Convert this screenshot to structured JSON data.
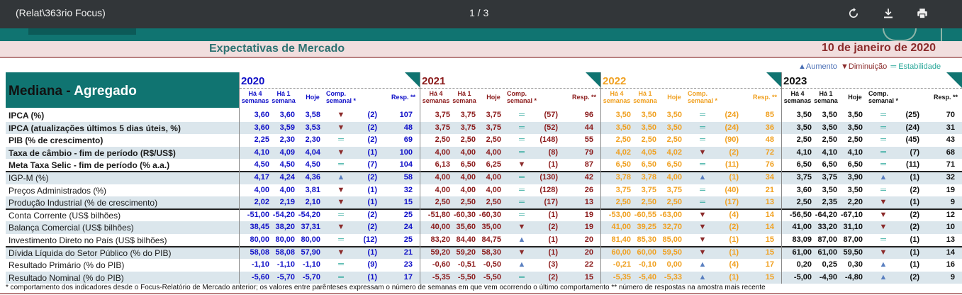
{
  "viewer": {
    "doc_title": "(Relat\\363rio Focus)",
    "page_indicator": "1 / 3"
  },
  "report": {
    "title": "Expectativas de Mercado",
    "date": "10 de janeiro de 2020",
    "table_heading_dark": "Mediana - ",
    "table_heading_white": "Agregado",
    "legend": {
      "up": "▲Aumento",
      "down": "▼Diminuição",
      "stable": "═ Estabilidade"
    },
    "col_headers": {
      "h4": "Há 4\nsemanas",
      "h1": "Há 1\nsemana",
      "hoje": "Hoje",
      "comp": "Comp.\nsemanal *",
      "resp": "Resp. **"
    },
    "footnote": "* comportamento dos indicadores desde o Focus-Relatório de Mercado anterior; os valores entre parênteses expressam o número de semanas em que vem ocorrendo o último comportamento ** número de respostas na amostra mais recente"
  },
  "colors": {
    "teal": "#107471",
    "y2020": "#1010c8",
    "y2021": "#8b1a1a",
    "y2022": "#f0a020",
    "y2023": "#111111"
  },
  "years": [
    "2020",
    "2021",
    "2022",
    "2023"
  ],
  "rows": [
    {
      "label": "IPCA (%)",
      "bold": true,
      "shade": false,
      "div": false,
      "y": [
        [
          "3,60",
          "3,60",
          "3,58",
          "d",
          "(2)",
          "107"
        ],
        [
          "3,75",
          "3,75",
          "3,75",
          "s",
          "(57)",
          "96"
        ],
        [
          "3,50",
          "3,50",
          "3,50",
          "s",
          "(24)",
          "85"
        ],
        [
          "3,50",
          "3,50",
          "3,50",
          "s",
          "(25)",
          "70"
        ]
      ]
    },
    {
      "label": "IPCA (atualizações últimos 5 dias úteis, %)",
      "bold": true,
      "shade": true,
      "div": false,
      "y": [
        [
          "3,60",
          "3,59",
          "3,53",
          "d",
          "(2)",
          "48"
        ],
        [
          "3,75",
          "3,75",
          "3,75",
          "s",
          "(52)",
          "44"
        ],
        [
          "3,50",
          "3,50",
          "3,50",
          "s",
          "(24)",
          "36"
        ],
        [
          "3,50",
          "3,50",
          "3,50",
          "s",
          "(24)",
          "31"
        ]
      ]
    },
    {
      "label": "PIB (% de crescimento)",
      "bold": true,
      "shade": false,
      "div": false,
      "y": [
        [
          "2,25",
          "2,30",
          "2,30",
          "s",
          "(2)",
          "69"
        ],
        [
          "2,50",
          "2,50",
          "2,50",
          "s",
          "(148)",
          "55"
        ],
        [
          "2,50",
          "2,50",
          "2,50",
          "s",
          "(90)",
          "48"
        ],
        [
          "2,50",
          "2,50",
          "2,50",
          "s",
          "(45)",
          "43"
        ]
      ]
    },
    {
      "label": "Taxa de câmbio - fim de período (R$/US$)",
      "bold": true,
      "shade": true,
      "div": false,
      "y": [
        [
          "4,10",
          "4,09",
          "4,04",
          "d",
          "(1)",
          "100"
        ],
        [
          "4,00",
          "4,00",
          "4,00",
          "s",
          "(8)",
          "79"
        ],
        [
          "4,02",
          "4,05",
          "4,02",
          "d",
          "(2)",
          "72"
        ],
        [
          "4,10",
          "4,10",
          "4,10",
          "s",
          "(7)",
          "68"
        ]
      ]
    },
    {
      "label": "Meta Taxa Selic - fim de período (% a.a.)",
      "bold": true,
      "shade": false,
      "div": false,
      "y": [
        [
          "4,50",
          "4,50",
          "4,50",
          "s",
          "(7)",
          "104"
        ],
        [
          "6,13",
          "6,50",
          "6,25",
          "d",
          "(1)",
          "87"
        ],
        [
          "6,50",
          "6,50",
          "6,50",
          "s",
          "(11)",
          "76"
        ],
        [
          "6,50",
          "6,50",
          "6,50",
          "s",
          "(11)",
          "71"
        ]
      ]
    },
    {
      "label": "IGP-M (%)",
      "bold": false,
      "shade": true,
      "div": true,
      "y": [
        [
          "4,17",
          "4,24",
          "4,36",
          "u",
          "(2)",
          "58"
        ],
        [
          "4,00",
          "4,00",
          "4,00",
          "s",
          "(130)",
          "42"
        ],
        [
          "3,78",
          "3,78",
          "4,00",
          "u",
          "(1)",
          "34"
        ],
        [
          "3,75",
          "3,75",
          "3,90",
          "u",
          "(1)",
          "32"
        ]
      ]
    },
    {
      "label": "Preços Administrados (%)",
      "bold": false,
      "shade": false,
      "div": false,
      "y": [
        [
          "4,00",
          "4,00",
          "3,81",
          "d",
          "(1)",
          "32"
        ],
        [
          "4,00",
          "4,00",
          "4,00",
          "s",
          "(128)",
          "26"
        ],
        [
          "3,75",
          "3,75",
          "3,75",
          "s",
          "(40)",
          "21"
        ],
        [
          "3,60",
          "3,50",
          "3,50",
          "s",
          "(2)",
          "19"
        ]
      ]
    },
    {
      "label": "Produção Industrial (% de crescimento)",
      "bold": false,
      "shade": true,
      "div": false,
      "y": [
        [
          "2,02",
          "2,19",
          "2,10",
          "d",
          "(1)",
          "15"
        ],
        [
          "2,50",
          "2,50",
          "2,50",
          "s",
          "(17)",
          "13"
        ],
        [
          "2,50",
          "2,50",
          "2,50",
          "s",
          "(17)",
          "13"
        ],
        [
          "2,50",
          "2,35",
          "2,20",
          "d",
          "(1)",
          "9"
        ]
      ]
    },
    {
      "label": "Conta Corrente (US$ bilhões)",
      "bold": false,
      "shade": false,
      "div": true,
      "y": [
        [
          "-51,00",
          "-54,20",
          "-54,20",
          "s",
          "(2)",
          "25"
        ],
        [
          "-51,80",
          "-60,30",
          "-60,30",
          "s",
          "(1)",
          "19"
        ],
        [
          "-53,00",
          "-60,55",
          "-63,00",
          "d",
          "(4)",
          "14"
        ],
        [
          "-56,50",
          "-64,20",
          "-67,10",
          "d",
          "(2)",
          "12"
        ]
      ]
    },
    {
      "label": "Balança Comercial (US$ bilhões)",
      "bold": false,
      "shade": true,
      "div": false,
      "y": [
        [
          "38,45",
          "38,20",
          "37,31",
          "d",
          "(2)",
          "24"
        ],
        [
          "40,00",
          "35,60",
          "35,00",
          "d",
          "(2)",
          "19"
        ],
        [
          "41,00",
          "39,25",
          "32,70",
          "d",
          "(2)",
          "14"
        ],
        [
          "41,00",
          "33,20",
          "31,10",
          "d",
          "(2)",
          "10"
        ]
      ]
    },
    {
      "label": "Investimento Direto no País (US$ bilhões)",
      "bold": false,
      "shade": false,
      "div": false,
      "y": [
        [
          "80,00",
          "80,00",
          "80,00",
          "s",
          "(12)",
          "25"
        ],
        [
          "83,20",
          "84,40",
          "84,75",
          "u",
          "(1)",
          "20"
        ],
        [
          "81,40",
          "85,30",
          "85,00",
          "d",
          "(1)",
          "15"
        ],
        [
          "83,09",
          "87,00",
          "87,00",
          "s",
          "(1)",
          "13"
        ]
      ]
    },
    {
      "label": "Dívida Líquida do Setor Público (% do PIB)",
      "bold": false,
      "shade": true,
      "div": true,
      "y": [
        [
          "58,08",
          "58,08",
          "57,90",
          "d",
          "(1)",
          "21"
        ],
        [
          "59,20",
          "59,20",
          "58,30",
          "d",
          "(1)",
          "20"
        ],
        [
          "60,00",
          "60,00",
          "59,50",
          "d",
          "(1)",
          "15"
        ],
        [
          "61,00",
          "61,00",
          "59,50",
          "d",
          "(1)",
          "14"
        ]
      ]
    },
    {
      "label": "Resultado Primário (% do PIB)",
      "bold": false,
      "shade": false,
      "div": false,
      "y": [
        [
          "-1,10",
          "-1,10",
          "-1,10",
          "s",
          "(9)",
          "23"
        ],
        [
          "-0,60",
          "-0,51",
          "-0,50",
          "u",
          "(3)",
          "22"
        ],
        [
          "-0,21",
          "-0,10",
          "0,00",
          "u",
          "(4)",
          "17"
        ],
        [
          "0,20",
          "0,25",
          "0,30",
          "u",
          "(1)",
          "16"
        ]
      ]
    },
    {
      "label": "Resultado Nominal (% do PIB)",
      "bold": false,
      "shade": true,
      "div": false,
      "y": [
        [
          "-5,60",
          "-5,70",
          "-5,70",
          "s",
          "(1)",
          "17"
        ],
        [
          "-5,35",
          "-5,50",
          "-5,50",
          "s",
          "(2)",
          "15"
        ],
        [
          "-5,35",
          "-5,40",
          "-5,33",
          "u",
          "(1)",
          "15"
        ],
        [
          "-5,00",
          "-4,90",
          "-4,80",
          "u",
          "(2)",
          "9"
        ]
      ]
    }
  ]
}
